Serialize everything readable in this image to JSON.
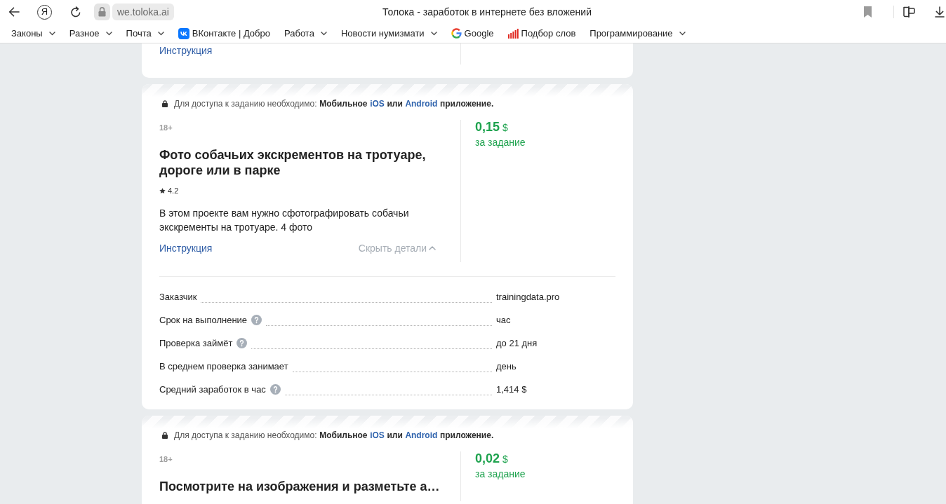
{
  "browser": {
    "logo_letter": "Я",
    "address": "we.toloka.ai",
    "page_title": "Толока - заработок в интернете без вложений",
    "bookmarks": [
      {
        "label": "Законы",
        "kind": "folder"
      },
      {
        "label": "Разное",
        "kind": "folder"
      },
      {
        "label": "Почта",
        "kind": "folder"
      },
      {
        "label": "ВКонтакте | Добро",
        "kind": "vkontakte"
      },
      {
        "label": "Работа",
        "kind": "folder"
      },
      {
        "label": "Новости нумизмати",
        "kind": "folder"
      },
      {
        "label": "Google",
        "kind": "google"
      },
      {
        "label": "Подбор слов",
        "kind": "chart"
      },
      {
        "label": "Программирование",
        "kind": "folder"
      }
    ]
  },
  "tasks": [
    {
      "instruction_link": "Инструкция"
    },
    {
      "access": {
        "lead": "Для доступа к заданию необходимо:",
        "parts": [
          {
            "text": "Мобильное",
            "kind": "bold"
          },
          {
            "text": "iOS",
            "kind": "link"
          },
          {
            "text": "или",
            "kind": "bold"
          },
          {
            "text": "Android",
            "kind": "link"
          },
          {
            "text": "приложение.",
            "kind": "bold"
          }
        ]
      },
      "age": "18+",
      "title": "Фото собачьих экскрементов на тротуаре, дороге или в парке",
      "rating": "4.2",
      "description": "В этом проекте вам нужно сфотографировать собачьи экскременты на тротуаре. 4 фото",
      "instruction_link": "Инструкция",
      "details_toggle": {
        "label": "Скрыть детали",
        "expanded": true
      },
      "price": "0,15",
      "currency": "$",
      "price_caption": "за задание",
      "details": [
        {
          "label": "Заказчик",
          "help": false,
          "value": "trainingdata.pro"
        },
        {
          "label": "Срок на выполнение",
          "help": true,
          "value": "час"
        },
        {
          "label": "Проверка займёт",
          "help": true,
          "value": "до 21 дня"
        },
        {
          "label": "В среднем проверка занимает",
          "help": false,
          "value": "день"
        },
        {
          "label": "Средний заработок в час",
          "help": true,
          "value": "1,414 $"
        }
      ]
    },
    {
      "access": {
        "lead": "Для доступа к заданию необходимо:",
        "parts": [
          {
            "text": "Мобильное",
            "kind": "bold"
          },
          {
            "text": "iOS",
            "kind": "link"
          },
          {
            "text": "или",
            "kind": "bold"
          },
          {
            "text": "Android",
            "kind": "link"
          },
          {
            "text": "приложение.",
            "kind": "bold"
          }
        ]
      },
      "age": "18+",
      "title": "Посмотрите на изображения и разметьте а…",
      "price": "0,02",
      "currency": "$",
      "price_caption": "за задание"
    }
  ]
}
